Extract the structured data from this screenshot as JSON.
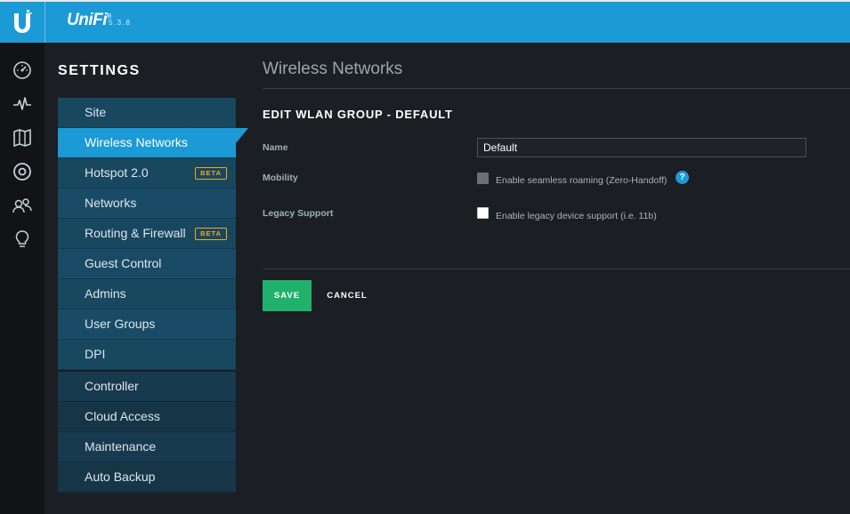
{
  "header": {
    "brand": "UniFi",
    "brand_mark": "®",
    "version": "5.3.8"
  },
  "nav_icons": [
    "dashboard-icon",
    "statistics-icon",
    "map-icon",
    "devices-icon",
    "clients-icon",
    "insights-icon"
  ],
  "settings": {
    "title": "SETTINGS",
    "items": [
      {
        "label": "Site",
        "active": false
      },
      {
        "label": "Wireless Networks",
        "active": true
      },
      {
        "label": "Hotspot 2.0",
        "badge": "BETA"
      },
      {
        "label": "Networks"
      },
      {
        "label": "Routing & Firewall",
        "badge": "BETA"
      },
      {
        "label": "Guest Control"
      },
      {
        "label": "Admins"
      },
      {
        "label": "User Groups"
      },
      {
        "label": "DPI"
      }
    ],
    "items2": [
      {
        "label": "Controller"
      },
      {
        "label": "Cloud Access"
      },
      {
        "label": "Maintenance"
      },
      {
        "label": "Auto Backup"
      }
    ]
  },
  "main": {
    "page_title": "Wireless Networks",
    "section_title": "EDIT WLAN GROUP - DEFAULT",
    "fields": {
      "name_label": "Name",
      "name_value": "Default",
      "mobility_label": "Mobility",
      "mobility_option": "Enable seamless roaming (Zero-Handoff)",
      "mobility_checked": false,
      "mobility_disabled": true,
      "legacy_label": "Legacy Support",
      "legacy_option": "Enable legacy device support (i.e. 11b)",
      "legacy_checked": false
    },
    "help_glyph": "?",
    "buttons": {
      "save": "SAVE",
      "cancel": "CANCEL"
    }
  },
  "colors": {
    "accent": "#1c9ad6",
    "save": "#20b26c",
    "badge": "#f5a623"
  }
}
